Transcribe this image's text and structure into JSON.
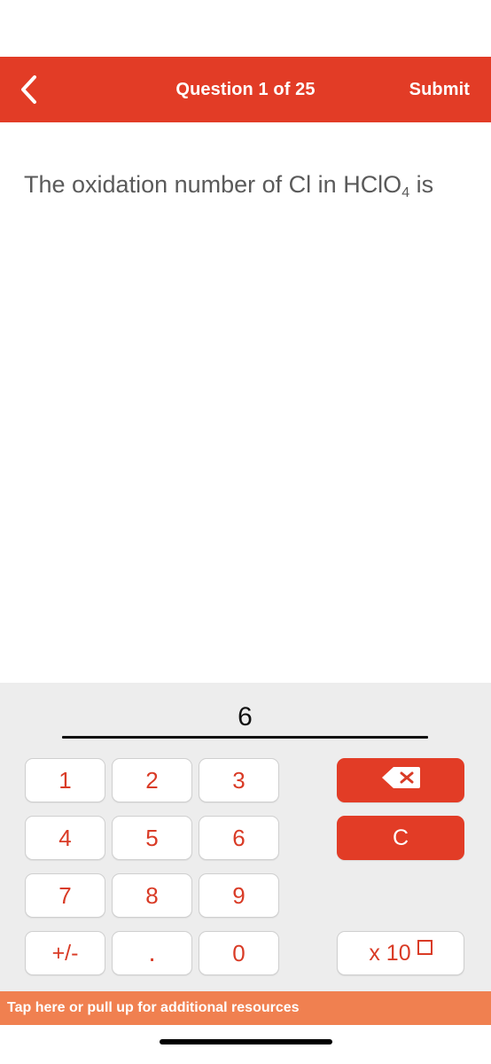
{
  "header": {
    "back_icon": "chevron-left-icon",
    "title": "Question 1 of 25",
    "submit_label": "Submit",
    "background_color": "#E23C26",
    "text_color": "#ffffff"
  },
  "question": {
    "text_before": "The oxidation number of Cl in HClO",
    "subscript": "4",
    "text_after": " is",
    "text_color": "#5A5A5A"
  },
  "answer": {
    "value": "6"
  },
  "keypad": {
    "keys": [
      {
        "label": "1",
        "name": "key-1"
      },
      {
        "label": "2",
        "name": "key-2"
      },
      {
        "label": "3",
        "name": "key-3"
      },
      {
        "label": "4",
        "name": "key-4"
      },
      {
        "label": "5",
        "name": "key-5"
      },
      {
        "label": "6",
        "name": "key-6"
      },
      {
        "label": "7",
        "name": "key-7"
      },
      {
        "label": "8",
        "name": "key-8"
      },
      {
        "label": "9",
        "name": "key-9"
      },
      {
        "label": "+/-",
        "name": "key-sign"
      },
      {
        "label": ".",
        "name": "key-decimal"
      },
      {
        "label": "0",
        "name": "key-0"
      }
    ],
    "backspace_icon": "backspace-icon",
    "clear_label": "C",
    "exponent_label": "x 10",
    "key_text_color": "#D93B26",
    "panel_color": "#EDEDED"
  },
  "footer": {
    "resources_label": "Tap here or pull up for additional resources",
    "background_color": "#F08050"
  }
}
